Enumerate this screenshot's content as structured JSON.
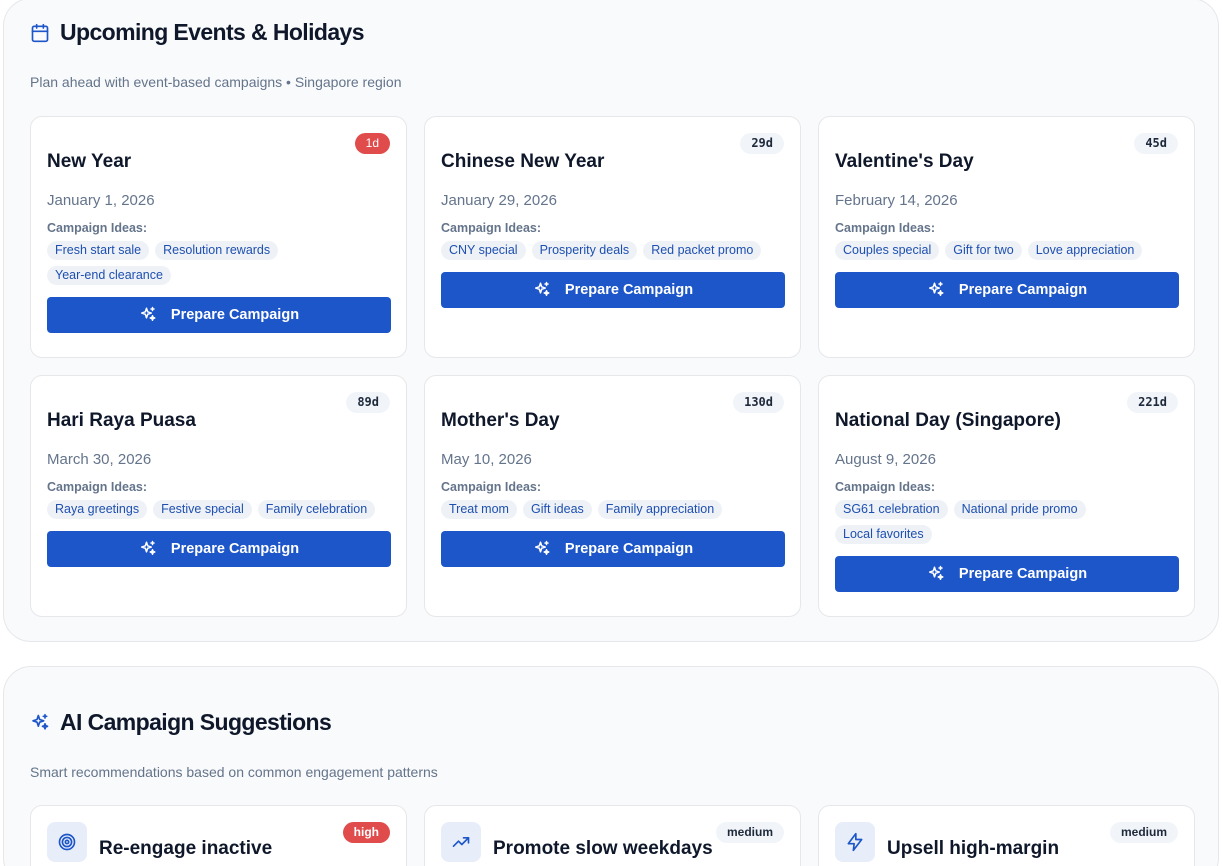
{
  "colors": {
    "accent": "#1d56c9",
    "urgent": "#e04b4b",
    "tag_bg": "#eef2f7",
    "tag_text": "#1e4fb0"
  },
  "events_section": {
    "icon": "calendar-icon",
    "title": "Upcoming Events & Holidays",
    "subtitle": "Plan ahead with event-based campaigns • Singapore region",
    "ideas_label": "Campaign Ideas:",
    "button_label": "Prepare Campaign",
    "events": [
      {
        "name": "New Year",
        "date": "January 1, 2026",
        "days": "1d",
        "urgent": true,
        "ideas": [
          "Fresh start sale",
          "Resolution rewards",
          "Year-end clearance"
        ]
      },
      {
        "name": "Chinese New Year",
        "date": "January 29, 2026",
        "days": "29d",
        "urgent": false,
        "ideas": [
          "CNY special",
          "Prosperity deals",
          "Red packet promo"
        ]
      },
      {
        "name": "Valentine's Day",
        "date": "February 14, 2026",
        "days": "45d",
        "urgent": false,
        "ideas": [
          "Couples special",
          "Gift for two",
          "Love appreciation"
        ]
      },
      {
        "name": "Hari Raya Puasa",
        "date": "March 30, 2026",
        "days": "89d",
        "urgent": false,
        "ideas": [
          "Raya greetings",
          "Festive special",
          "Family celebration"
        ]
      },
      {
        "name": "Mother's Day",
        "date": "May 10, 2026",
        "days": "130d",
        "urgent": false,
        "ideas": [
          "Treat mom",
          "Gift ideas",
          "Family appreciation"
        ]
      },
      {
        "name": "National Day (Singapore)",
        "date": "August 9, 2026",
        "days": "221d",
        "urgent": false,
        "ideas": [
          "SG61 celebration",
          "National pride promo",
          "Local favorites"
        ]
      }
    ]
  },
  "ai_section": {
    "icon": "sparkles-icon",
    "title": "AI Campaign Suggestions",
    "subtitle": "Smart recommendations based on common engagement patterns",
    "suggestions": [
      {
        "icon": "target-icon",
        "title": "Re-engage inactive",
        "priority": "high"
      },
      {
        "icon": "trending-up-icon",
        "title": "Promote slow weekdays",
        "priority": "medium"
      },
      {
        "icon": "lightning-icon",
        "title": "Upsell high-margin",
        "priority": "medium"
      }
    ]
  }
}
